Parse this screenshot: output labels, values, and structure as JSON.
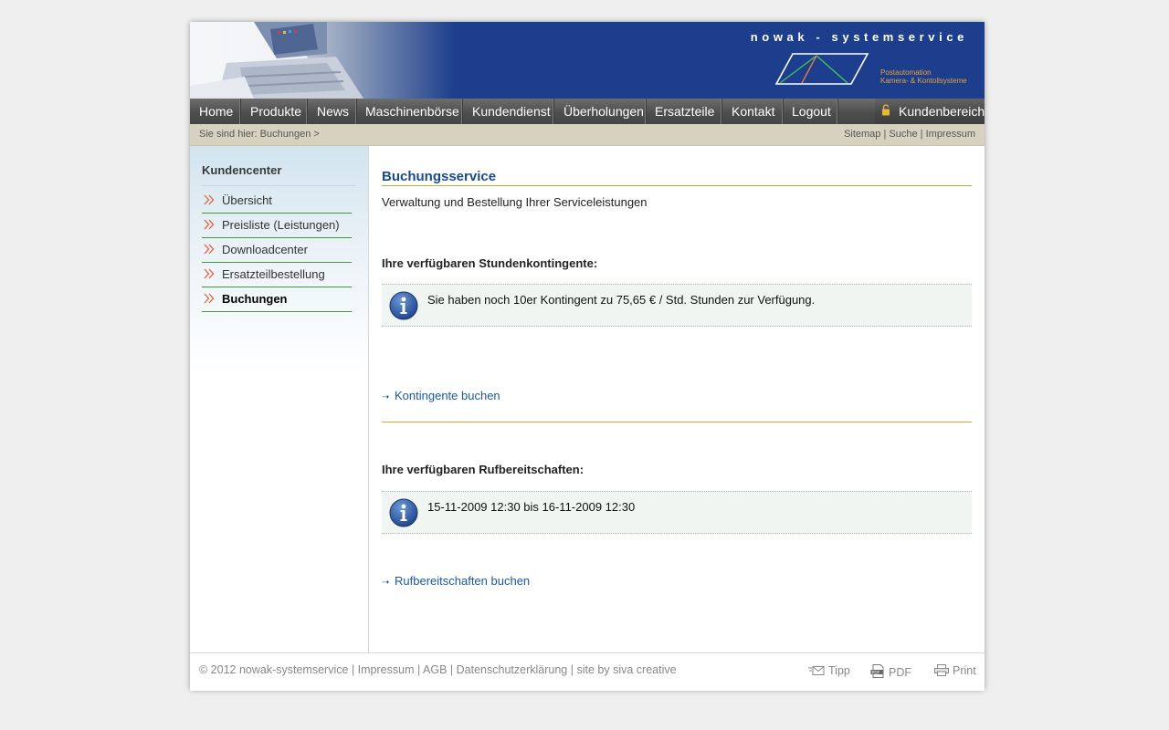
{
  "header": {
    "brand": "nowak - systemservice",
    "tagline": [
      "Postautomation",
      "Kamera- & Kontollsysteme"
    ]
  },
  "nav": {
    "items": [
      "Home",
      "Produkte",
      "News",
      "Maschinenbörse",
      "Kundendienst",
      "Überholungen",
      "Ersatzteile",
      "Kontakt",
      "Logout"
    ],
    "kundenbereich": "Kundenbereich"
  },
  "breadcrumb": {
    "text": "Sie sind hier: Buchungen >",
    "links": [
      "Sitemap",
      "Suche",
      "Impressum"
    ],
    "separator": "|"
  },
  "sidebar": {
    "title": "Kundencenter",
    "items": [
      {
        "label": "Übersicht"
      },
      {
        "label": "Preisliste (Leistungen)"
      },
      {
        "label": "Downloadcenter"
      },
      {
        "label": "Ersatzteilbestellung"
      },
      {
        "label": "Buchungen",
        "active": true
      }
    ]
  },
  "main": {
    "title": "Buchungsservice",
    "subtitle": "Verwaltung und Bestellung Ihrer Serviceleistungen",
    "kontingente": {
      "heading": "Ihre verfügbaren Stundenkontingente:",
      "info": "Sie haben noch 10er Kontingent zu 75,65 € / Std. Stunden zur Verfügung.",
      "link": "Kontingente buchen"
    },
    "rufbereitschaften": {
      "heading": "Ihre verfügbaren Rufbereitschaften:",
      "info": "15-11-2009 12:30 bis 16-11-2009 12:30",
      "link": "Rufbereitschaften buchen"
    }
  },
  "footer": {
    "copyright": "© 2012 nowak-systemservice",
    "links": [
      "Impressum",
      "AGB",
      "Datenschutzerklärung",
      "site by siva creative"
    ],
    "separator": "|",
    "tools": {
      "tipp": "Tipp",
      "pdf": "PDF",
      "print": "Print"
    }
  },
  "colors": {
    "banner": "#1c3e8c",
    "heading": "#1a4a8a",
    "link": "#1a5a9a",
    "accent_gold": "#c8a836",
    "accent_orange": "#e8a23a",
    "menu_rule_green": "#3f9a3a"
  },
  "icons": [
    "lock-icon",
    "arrow-right-icon",
    "info-icon",
    "envelope-icon",
    "pdf-icon",
    "printer-icon"
  ]
}
